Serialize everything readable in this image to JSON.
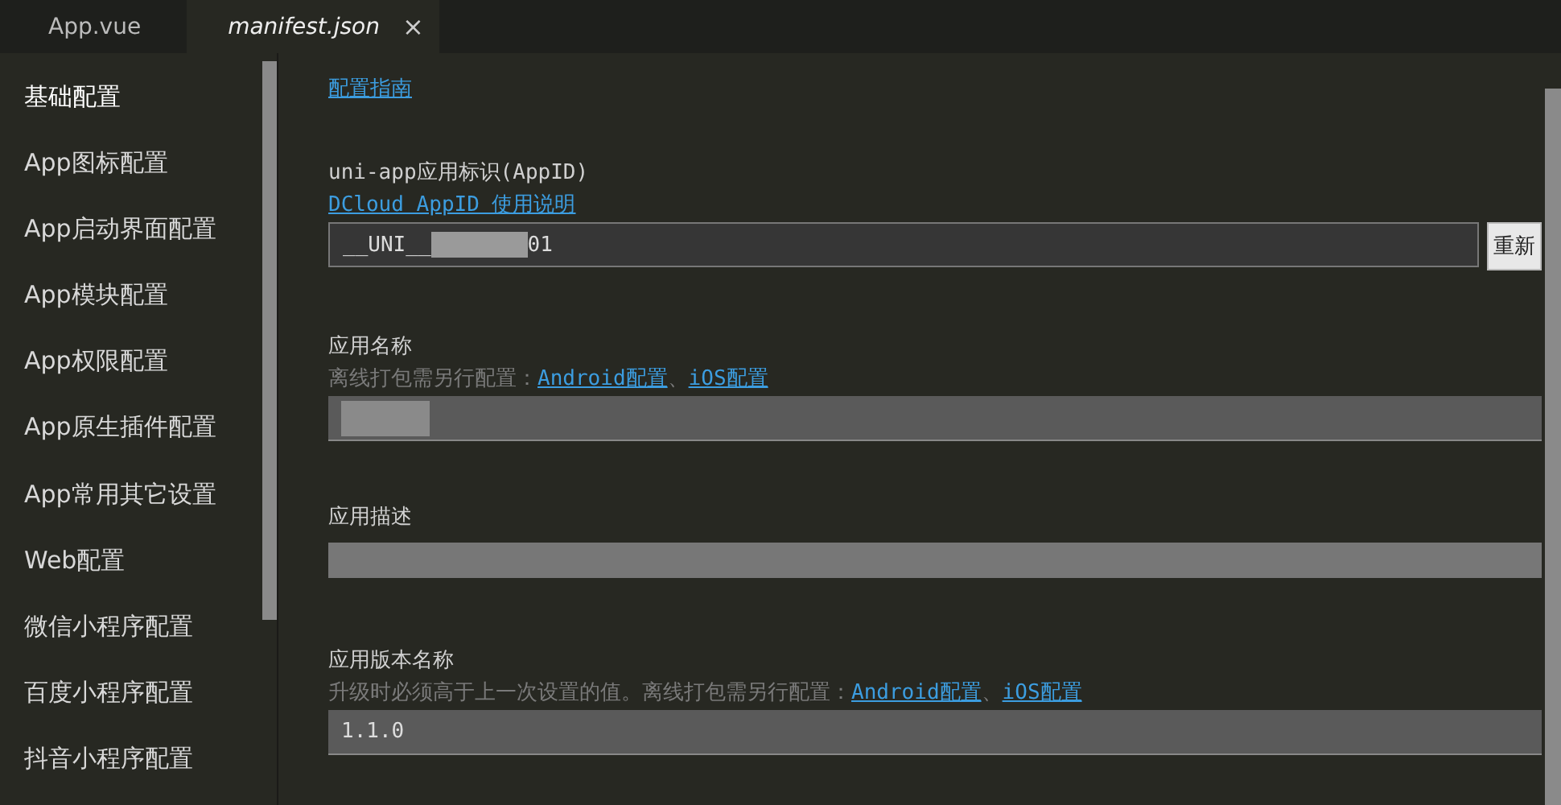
{
  "tabs": [
    {
      "label": "App.vue",
      "selected": false
    },
    {
      "label": "manifest.json",
      "selected": true,
      "close_glyph": "×"
    }
  ],
  "sidebar": {
    "items": [
      {
        "label": "基础配置",
        "selected": true
      },
      {
        "label": "App图标配置",
        "selected": false
      },
      {
        "label": "App启动界面配置",
        "selected": false
      },
      {
        "label": "App模块配置",
        "selected": false
      },
      {
        "label": "App权限配置",
        "selected": false
      },
      {
        "label": "App原生插件配置",
        "selected": false
      },
      {
        "label": "App常用其它设置",
        "selected": false
      },
      {
        "label": "Web配置",
        "selected": false
      },
      {
        "label": "微信小程序配置",
        "selected": false
      },
      {
        "label": "百度小程序配置",
        "selected": false
      },
      {
        "label": "抖音小程序配置",
        "selected": false
      }
    ]
  },
  "guide_link": "配置指南",
  "fields": [
    {
      "kind": "input",
      "label": "uni-app应用标识(AppID)",
      "links": [
        "DCloud AppID 使用说明"
      ],
      "value": "__UNI__",
      "redacted": true,
      "value_tail": "01",
      "button": "重新"
    },
    {
      "kind": "input",
      "label": "应用名称",
      "hint": "离线打包需另行配置：",
      "links": [
        "Android配置",
        "iOS配置"
      ],
      "separator": "、",
      "redacted": true
    },
    {
      "kind": "text",
      "label": "应用描述",
      "redacted": true
    },
    {
      "kind": "input",
      "label": "应用版本名称",
      "hint": "升级时必须高于上一次设置的值。离线打包需另行配置：",
      "links": [
        "Android配置",
        "iOS配置"
      ],
      "separator": "、",
      "value": "1.1.0"
    }
  ]
}
